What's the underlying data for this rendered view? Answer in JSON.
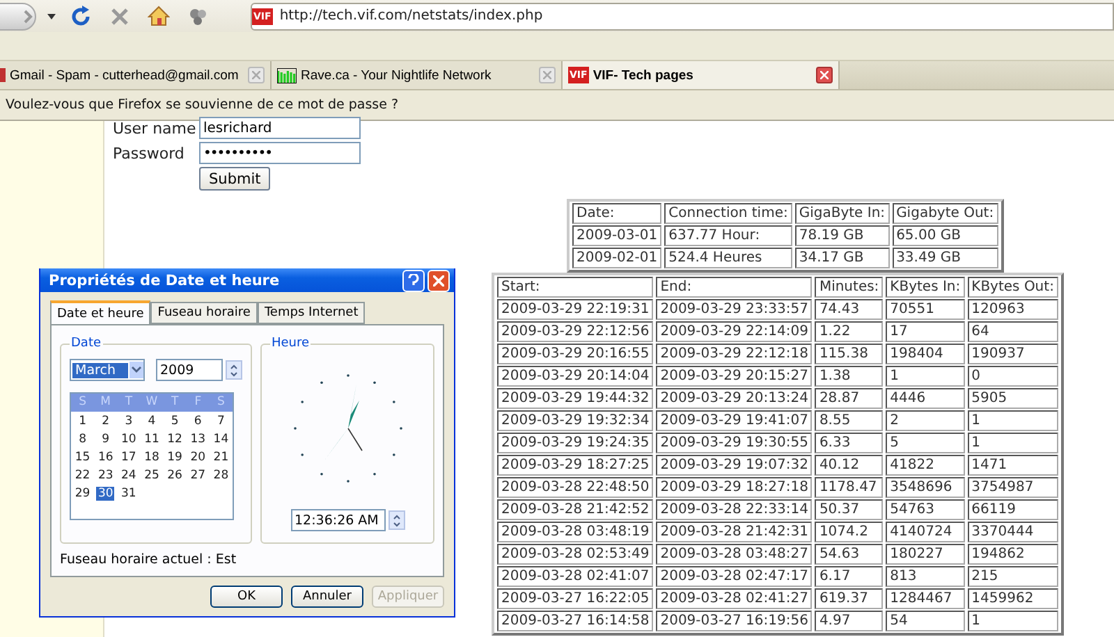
{
  "browser": {
    "url": "http://tech.vif.com/netstats/index.php",
    "favicon_text": "VIF",
    "tabs": [
      {
        "title": "Gmail - Spam - cutterhead@gmail.com",
        "kind": "mail",
        "selected": false
      },
      {
        "title": "Rave.ca - Your Nightlife Network",
        "kind": "bars",
        "selected": false
      },
      {
        "title": "VIF- Tech pages",
        "kind": "vif",
        "favicon_text": "VIF",
        "selected": true
      }
    ],
    "notification": "Voulez-vous que Firefox se souvienne de ce mot de passe ?"
  },
  "login": {
    "fields": [
      {
        "label": "User name",
        "value": "lesrichard",
        "kind": "text"
      },
      {
        "label": "Password",
        "value": "••••••••••",
        "kind": "password"
      }
    ],
    "submit": "Submit"
  },
  "summary_table": {
    "columns": [
      "Date:",
      "Connection time:",
      "GigaByte In:",
      "Gigabyte Out:"
    ],
    "rows": [
      [
        "2009-03-01",
        "637.77 Hour:",
        "78.19 GB",
        "65.00 GB"
      ],
      [
        "2009-02-01",
        "524.4 Heures",
        "34.17 GB",
        "33.49 GB"
      ]
    ]
  },
  "sessions_table": {
    "columns": [
      "Start:",
      "End:",
      "Minutes:",
      "KBytes In:",
      "KBytes Out:"
    ],
    "rows": [
      [
        "2009-03-29 22:19:31",
        "2009-03-29 23:33:57",
        "74.43",
        "70551",
        "120963"
      ],
      [
        "2009-03-29 22:12:56",
        "2009-03-29 22:14:09",
        "1.22",
        "17",
        "64"
      ],
      [
        "2009-03-29 20:16:55",
        "2009-03-29 22:12:18",
        "115.38",
        "198404",
        "190937"
      ],
      [
        "2009-03-29 20:14:04",
        "2009-03-29 20:15:27",
        "1.38",
        "1",
        "0"
      ],
      [
        "2009-03-29 19:44:32",
        "2009-03-29 20:13:24",
        "28.87",
        "4446",
        "5905"
      ],
      [
        "2009-03-29 19:32:34",
        "2009-03-29 19:41:07",
        "8.55",
        "2",
        "1"
      ],
      [
        "2009-03-29 19:24:35",
        "2009-03-29 19:30:55",
        "6.33",
        "5",
        "1"
      ],
      [
        "2009-03-29 18:27:25",
        "2009-03-29 19:07:32",
        "40.12",
        "41822",
        "1471"
      ],
      [
        "2009-03-28 22:48:50",
        "2009-03-29 18:27:18",
        "1178.47",
        "3548696",
        "3754987"
      ],
      [
        "2009-03-28 21:42:52",
        "2009-03-28 22:33:14",
        "50.37",
        "54763",
        "66119"
      ],
      [
        "2009-03-28 03:48:19",
        "2009-03-28 21:42:31",
        "1074.2",
        "4140724",
        "3370444"
      ],
      [
        "2009-03-28 02:53:49",
        "2009-03-28 03:48:27",
        "54.63",
        "180227",
        "194862"
      ],
      [
        "2009-03-28 02:41:07",
        "2009-03-28 02:47:17",
        "6.17",
        "813",
        "215"
      ],
      [
        "2009-03-27 16:22:05",
        "2009-03-28 02:41:27",
        "619.37",
        "1284467",
        "1459962"
      ],
      [
        "2009-03-27 16:14:58",
        "2009-03-27 16:19:56",
        "4.97",
        "54",
        "1"
      ]
    ]
  },
  "dialog": {
    "title": "Propriétés de Date et heure",
    "tabs": [
      {
        "label": "Date et heure",
        "selected": true
      },
      {
        "label": "Fuseau horaire",
        "selected": false
      },
      {
        "label": "Temps Internet",
        "selected": false
      }
    ],
    "date_group": "Date",
    "month": "March",
    "year": "2009",
    "weekdays": [
      "S",
      "M",
      "T",
      "W",
      "T",
      "F",
      "S"
    ],
    "days": [
      {
        "label": "1",
        "selected": false
      },
      {
        "label": "2",
        "selected": false
      },
      {
        "label": "3",
        "selected": false
      },
      {
        "label": "4",
        "selected": false
      },
      {
        "label": "5",
        "selected": false
      },
      {
        "label": "6",
        "selected": false
      },
      {
        "label": "7",
        "selected": false
      },
      {
        "label": "8",
        "selected": false
      },
      {
        "label": "9",
        "selected": false
      },
      {
        "label": "10",
        "selected": false
      },
      {
        "label": "11",
        "selected": false
      },
      {
        "label": "12",
        "selected": false
      },
      {
        "label": "13",
        "selected": false
      },
      {
        "label": "14",
        "selected": false
      },
      {
        "label": "15",
        "selected": false
      },
      {
        "label": "16",
        "selected": false
      },
      {
        "label": "17",
        "selected": false
      },
      {
        "label": "18",
        "selected": false
      },
      {
        "label": "19",
        "selected": false
      },
      {
        "label": "20",
        "selected": false
      },
      {
        "label": "21",
        "selected": false
      },
      {
        "label": "22",
        "selected": false
      },
      {
        "label": "23",
        "selected": false
      },
      {
        "label": "24",
        "selected": false
      },
      {
        "label": "25",
        "selected": false
      },
      {
        "label": "26",
        "selected": false
      },
      {
        "label": "27",
        "selected": false
      },
      {
        "label": "28",
        "selected": false
      },
      {
        "label": "29",
        "selected": false
      },
      {
        "label": "30",
        "selected": true
      },
      {
        "label": "31",
        "selected": false
      }
    ],
    "time_group": "Heure",
    "time": "12:36:26 AM",
    "timezone": "Fuseau horaire actuel : Est",
    "buttons": [
      {
        "label": "OK",
        "disabled": false
      },
      {
        "label": "Annuler",
        "disabled": false
      },
      {
        "label": "Appliquer",
        "disabled": true
      }
    ]
  }
}
